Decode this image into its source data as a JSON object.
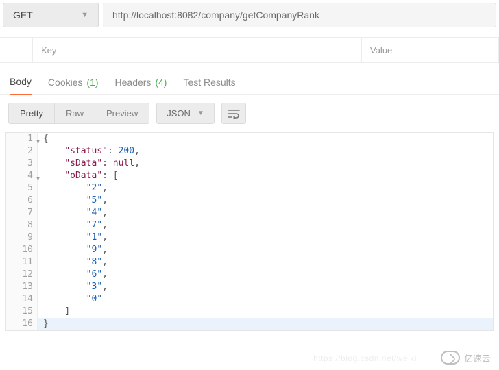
{
  "request": {
    "method": "GET",
    "url": "http://localhost:8082/company/getCompanyRank"
  },
  "params": {
    "key_placeholder": "Key",
    "value_placeholder": "Value"
  },
  "response_tabs": [
    {
      "label": "Body",
      "count": null,
      "active": true
    },
    {
      "label": "Cookies",
      "count": "(1)",
      "active": false
    },
    {
      "label": "Headers",
      "count": "(4)",
      "active": false
    },
    {
      "label": "Test Results",
      "count": null,
      "active": false
    }
  ],
  "view_modes": {
    "pretty": "Pretty",
    "raw": "Raw",
    "preview": "Preview"
  },
  "format_select": "JSON",
  "code_lines": [
    {
      "n": 1,
      "fold": true,
      "indent": 0,
      "tokens": [
        [
          "p",
          "{"
        ]
      ]
    },
    {
      "n": 2,
      "fold": false,
      "indent": 1,
      "tokens": [
        [
          "k",
          "\"status\""
        ],
        [
          "p",
          ": "
        ],
        [
          "n",
          "200"
        ],
        [
          "p",
          ","
        ]
      ]
    },
    {
      "n": 3,
      "fold": false,
      "indent": 1,
      "tokens": [
        [
          "k",
          "\"sData\""
        ],
        [
          "p",
          ": "
        ],
        [
          "u",
          "null"
        ],
        [
          "p",
          ","
        ]
      ]
    },
    {
      "n": 4,
      "fold": true,
      "indent": 1,
      "tokens": [
        [
          "k",
          "\"oData\""
        ],
        [
          "p",
          ": ["
        ]
      ]
    },
    {
      "n": 5,
      "fold": false,
      "indent": 2,
      "tokens": [
        [
          "s",
          "\"2\""
        ],
        [
          "p",
          ","
        ]
      ]
    },
    {
      "n": 6,
      "fold": false,
      "indent": 2,
      "tokens": [
        [
          "s",
          "\"5\""
        ],
        [
          "p",
          ","
        ]
      ]
    },
    {
      "n": 7,
      "fold": false,
      "indent": 2,
      "tokens": [
        [
          "s",
          "\"4\""
        ],
        [
          "p",
          ","
        ]
      ]
    },
    {
      "n": 8,
      "fold": false,
      "indent": 2,
      "tokens": [
        [
          "s",
          "\"7\""
        ],
        [
          "p",
          ","
        ]
      ]
    },
    {
      "n": 9,
      "fold": false,
      "indent": 2,
      "tokens": [
        [
          "s",
          "\"1\""
        ],
        [
          "p",
          ","
        ]
      ]
    },
    {
      "n": 10,
      "fold": false,
      "indent": 2,
      "tokens": [
        [
          "s",
          "\"9\""
        ],
        [
          "p",
          ","
        ]
      ]
    },
    {
      "n": 11,
      "fold": false,
      "indent": 2,
      "tokens": [
        [
          "s",
          "\"8\""
        ],
        [
          "p",
          ","
        ]
      ]
    },
    {
      "n": 12,
      "fold": false,
      "indent": 2,
      "tokens": [
        [
          "s",
          "\"6\""
        ],
        [
          "p",
          ","
        ]
      ]
    },
    {
      "n": 13,
      "fold": false,
      "indent": 2,
      "tokens": [
        [
          "s",
          "\"3\""
        ],
        [
          "p",
          ","
        ]
      ]
    },
    {
      "n": 14,
      "fold": false,
      "indent": 2,
      "tokens": [
        [
          "s",
          "\"0\""
        ]
      ]
    },
    {
      "n": 15,
      "fold": false,
      "indent": 1,
      "tokens": [
        [
          "p",
          "]"
        ]
      ]
    },
    {
      "n": 16,
      "fold": false,
      "indent": 0,
      "hl": true,
      "cursor": true,
      "tokens": [
        [
          "p",
          "}"
        ]
      ]
    }
  ],
  "watermark_right": "亿速云",
  "watermark_faint": "https://blog.csdn.net/weixi"
}
